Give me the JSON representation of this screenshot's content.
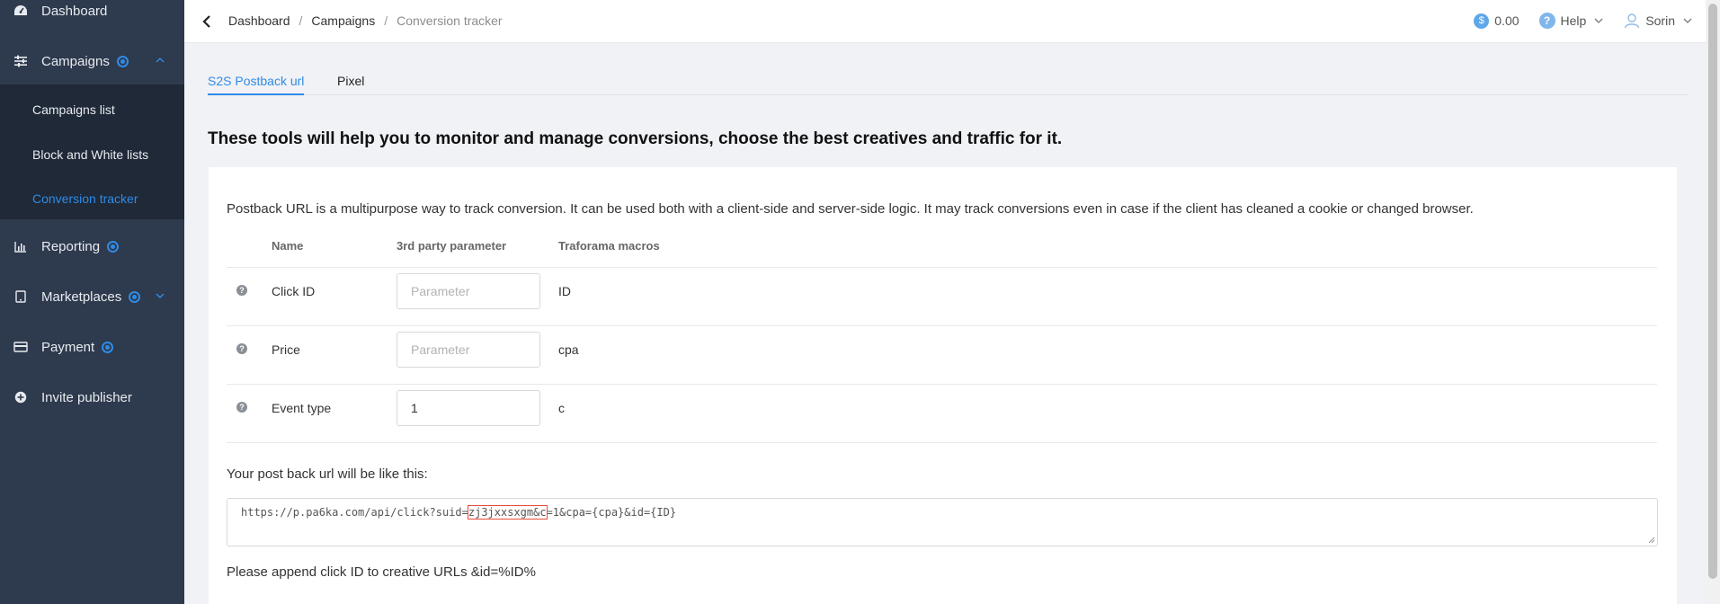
{
  "sidebar": {
    "items": [
      {
        "label": "Dashboard",
        "icon": "dashboard-icon"
      },
      {
        "label": "Campaigns",
        "icon": "sliders-icon"
      },
      {
        "label": "Reporting",
        "icon": "bar-chart-icon"
      },
      {
        "label": "Marketplaces",
        "icon": "tablet-icon"
      },
      {
        "label": "Payment",
        "icon": "credit-card-icon"
      },
      {
        "label": "Invite publisher",
        "icon": "plus-circle-icon"
      }
    ],
    "sub_items": [
      {
        "label": "Campaigns list"
      },
      {
        "label": "Block and White lists"
      },
      {
        "label": "Conversion tracker"
      }
    ]
  },
  "breadcrumb": {
    "items": [
      "Dashboard",
      "Campaigns",
      "Conversion tracker"
    ],
    "separator": "/"
  },
  "header": {
    "balance": "0.00",
    "balance_icon": "$",
    "help": "Help",
    "help_icon": "?",
    "user": "Sorin"
  },
  "tabs": [
    {
      "label": "S2S Postback url"
    },
    {
      "label": "Pixel"
    }
  ],
  "headline": "These tools will help you to monitor and manage conversions, choose the best creatives and traffic for it.",
  "description": "Postback URL is a multipurpose way to track conversion. It can be used both with a client-side and server-side logic. It may track conversions even in case if the client has cleaned a cookie or changed browser.",
  "table": {
    "headers": [
      "Name",
      "3rd party parameter",
      "Traforama macros"
    ],
    "help_glyph": "?",
    "rows": [
      {
        "name": "Click ID",
        "value": "",
        "placeholder": "Parameter",
        "macro": "ID"
      },
      {
        "name": "Price",
        "value": "",
        "placeholder": "Parameter",
        "macro": "cpa"
      },
      {
        "name": "Event type",
        "value": "1",
        "placeholder": "",
        "macro": "c"
      }
    ]
  },
  "postback": {
    "label": "Your post back url will be like this:",
    "url_prefix": "https://p.pa6ka.com/api/click?suid=",
    "url_highlight": "zj3jxxsxgm&c",
    "url_suffix": "=1&cpa={cpa}&id={ID}"
  },
  "append_note": "Please append click ID to creative URLs &id=%ID%",
  "colors": {
    "sidebar_bg": "#2e3a4d",
    "accent": "#2f8be6"
  }
}
